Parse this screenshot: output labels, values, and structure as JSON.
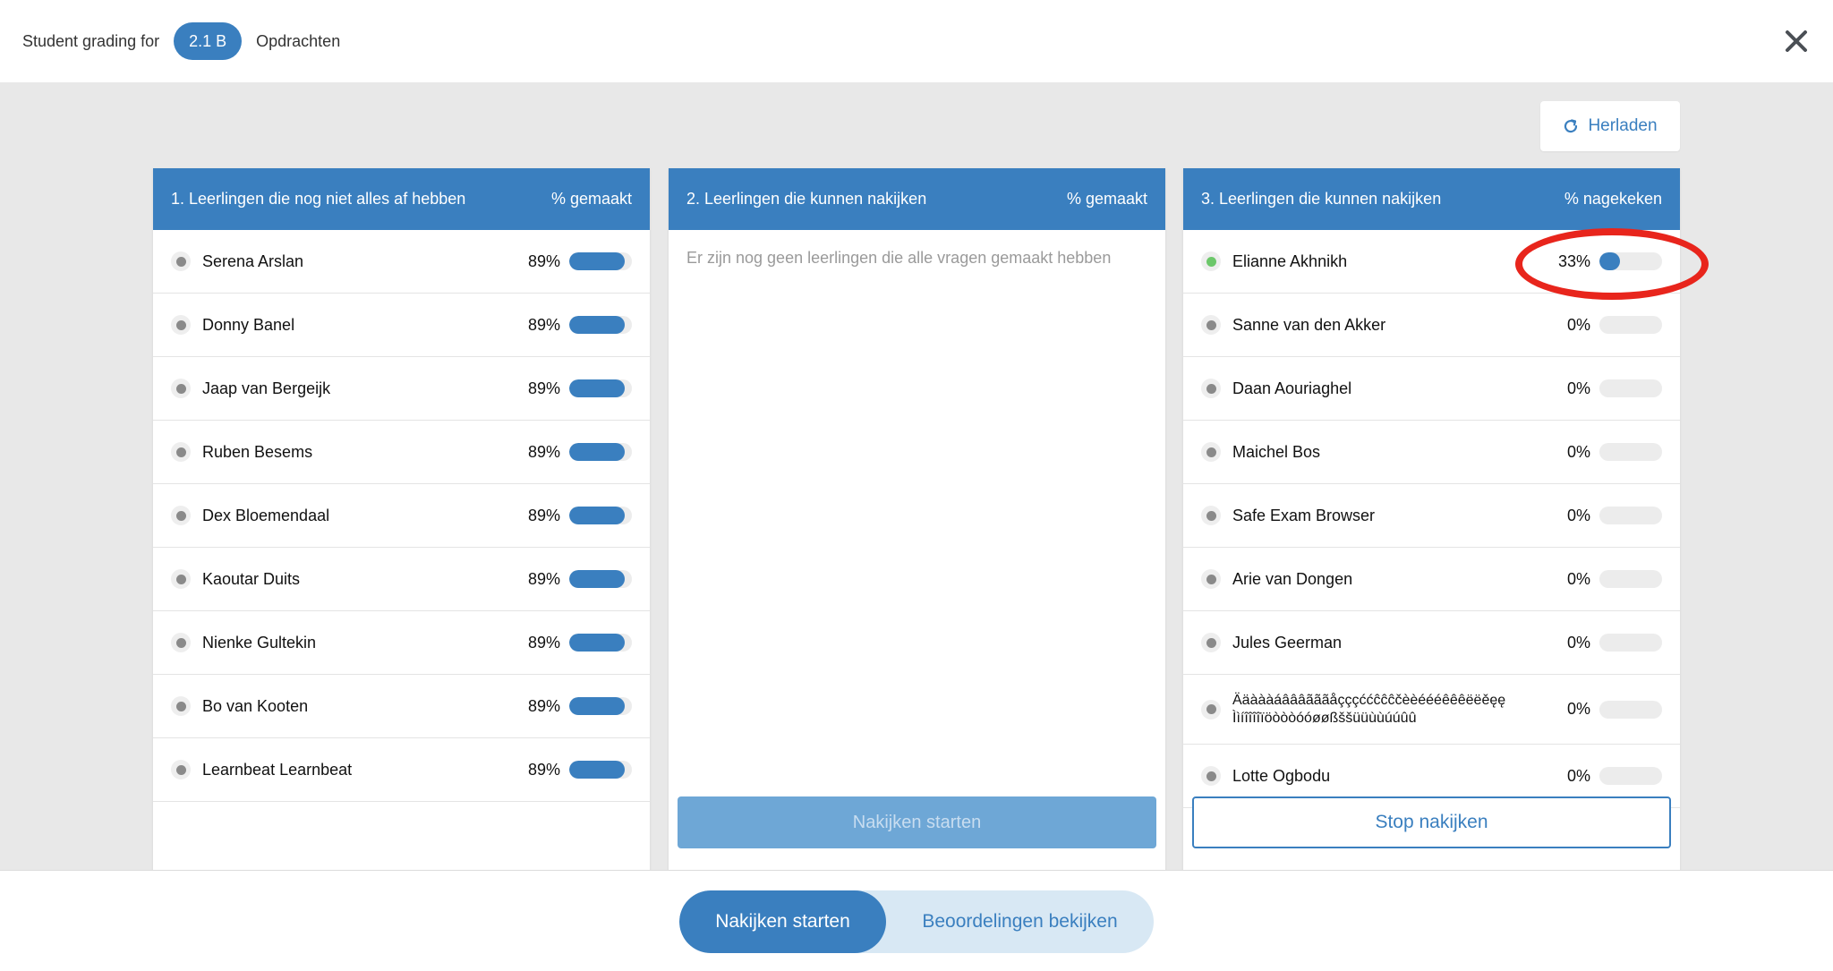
{
  "header": {
    "title": "Student grading for",
    "class_pill": "2.1 B",
    "crumb": "Opdrachten"
  },
  "reload_label": "Herladen",
  "columns": [
    {
      "title": "1. Leerlingen die nog niet alles af hebben",
      "metric": "% gemaakt",
      "rows": [
        {
          "name": "Serena Arslan",
          "pct": "89%",
          "value": 0.89,
          "active": false
        },
        {
          "name": "Donny Banel",
          "pct": "89%",
          "value": 0.89,
          "active": false
        },
        {
          "name": "Jaap van Bergeijk",
          "pct": "89%",
          "value": 0.89,
          "active": false
        },
        {
          "name": "Ruben Besems",
          "pct": "89%",
          "value": 0.89,
          "active": false
        },
        {
          "name": "Dex Bloemendaal",
          "pct": "89%",
          "value": 0.89,
          "active": false
        },
        {
          "name": "Kaoutar Duits",
          "pct": "89%",
          "value": 0.89,
          "active": false
        },
        {
          "name": "Nienke Gultekin",
          "pct": "89%",
          "value": 0.89,
          "active": false
        },
        {
          "name": "Bo van Kooten",
          "pct": "89%",
          "value": 0.89,
          "active": false
        },
        {
          "name": "Learnbeat Learnbeat",
          "pct": "89%",
          "value": 0.89,
          "active": false
        }
      ]
    },
    {
      "title": "2. Leerlingen die kunnen nakijken",
      "metric": "% gemaakt",
      "empty_text": "Er zijn nog geen leerlingen die alle vragen gemaakt hebben",
      "button": "Nakijken starten"
    },
    {
      "title": "3. Leerlingen die kunnen nakijken",
      "metric": "% nagekeken",
      "rows": [
        {
          "name": "Elianne Akhnikh",
          "pct": "33%",
          "value": 0.33,
          "active": true
        },
        {
          "name": "Sanne van den Akker",
          "pct": "0%",
          "value": 0,
          "active": false
        },
        {
          "name": "Daan Aouriaghel",
          "pct": "0%",
          "value": 0,
          "active": false
        },
        {
          "name": "Maichel Bos",
          "pct": "0%",
          "value": 0,
          "active": false
        },
        {
          "name": "Safe Exam Browser",
          "pct": "0%",
          "value": 0,
          "active": false
        },
        {
          "name": "Arie van Dongen",
          "pct": "0%",
          "value": 0,
          "active": false
        },
        {
          "name": "Jules Geerman",
          "pct": "0%",
          "value": 0,
          "active": false
        },
        {
          "name": "Ääàààáâââãããåçççććĉĉĉčèèéééêêêëëěęę Ììíîîîîïöòòòóóøøßššüüùùúúûû",
          "pct": "0%",
          "value": 0,
          "active": false
        },
        {
          "name": "Lotte Ogbodu",
          "pct": "0%",
          "value": 0,
          "active": false
        }
      ],
      "button": "Stop nakijken"
    }
  ],
  "bottom": {
    "start_label": "Nakijken starten",
    "view_label": "Beoordelingen bekijken"
  },
  "colors": {
    "accent": "#3a7fbf",
    "active_dot": "#6cc76a",
    "highlight": "#e8251c"
  }
}
